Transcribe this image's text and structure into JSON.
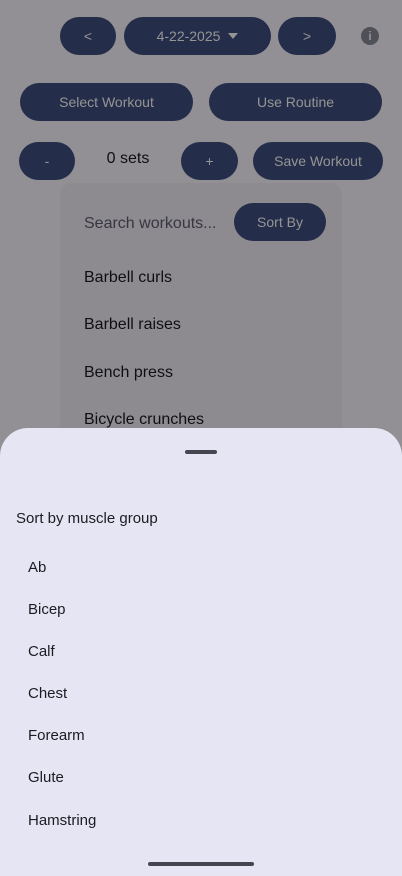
{
  "header": {
    "prev_label": "<",
    "date_label": "4-22-2025",
    "next_label": ">",
    "info_icon": "info-icon"
  },
  "actions": {
    "select_workout_label": "Select Workout",
    "use_routine_label": "Use Routine"
  },
  "sets_row": {
    "minus_label": "-",
    "sets_text": "0 sets",
    "plus_label": "+",
    "save_label": "Save Workout"
  },
  "workout_dialog": {
    "search_placeholder": "Search workouts...",
    "sort_label": "Sort By",
    "workouts": [
      "Barbell curls",
      "Barbell raises",
      "Bench press",
      "Bicycle crunches"
    ]
  },
  "sort_sheet": {
    "title": "Sort by muscle group",
    "groups": [
      "Ab",
      "Bicep",
      "Calf",
      "Chest",
      "Forearm",
      "Glute",
      "Hamstring"
    ]
  },
  "colors": {
    "accent": "#3e4e7e",
    "sheet_bg": "#e6e5f3",
    "dialog_bg": "#f3eff9"
  }
}
